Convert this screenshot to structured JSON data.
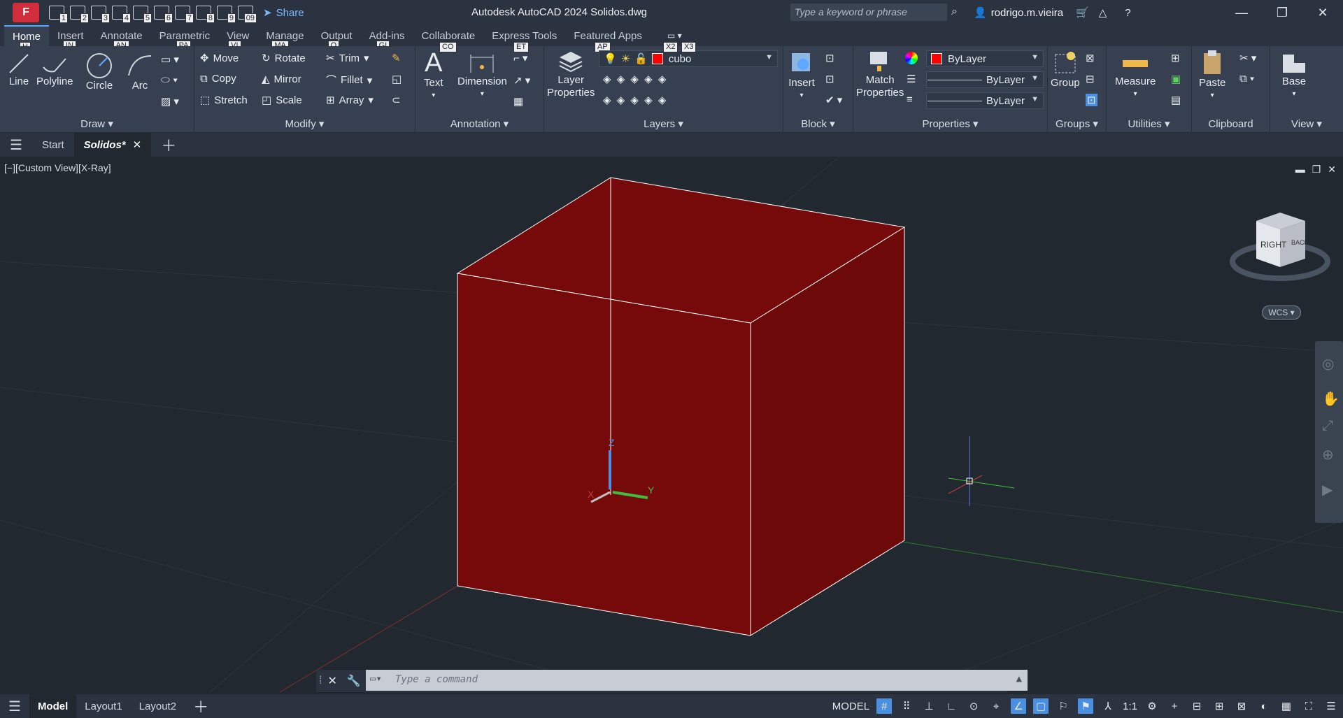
{
  "titlebar": {
    "app_title": "Autodesk AutoCAD 2024    Solidos.dwg",
    "logo_letter": "F",
    "qat_keys": [
      "1",
      "2",
      "3",
      "4",
      "5",
      "6",
      "7",
      "8",
      "9",
      "09"
    ],
    "share_label": "Share",
    "search_placeholder": "Type a keyword or phrase",
    "username": "rodrigo.m.vieira"
  },
  "ribbon_tabs": [
    {
      "label": "Home",
      "key": "H"
    },
    {
      "label": "Insert",
      "key": "IN"
    },
    {
      "label": "Annotate",
      "key": "AN"
    },
    {
      "label": "Parametric",
      "key": "PA"
    },
    {
      "label": "View",
      "key": "VI"
    },
    {
      "label": "Manage",
      "key": "MA"
    },
    {
      "label": "Output",
      "key": "O"
    },
    {
      "label": "Add-ins",
      "key": "GI"
    },
    {
      "label": "Collaborate",
      "key": ""
    },
    {
      "label": "Express Tools",
      "key": ""
    },
    {
      "label": "Featured Apps",
      "key": ""
    }
  ],
  "ribbon_extra_keys": {
    "co": "CO",
    "et": "ET",
    "ap": "AP",
    "x2": "X2",
    "x3": "X3"
  },
  "draw": {
    "panel": "Draw",
    "line": "Line",
    "polyline": "Polyline",
    "circle": "Circle",
    "arc": "Arc"
  },
  "modify": {
    "panel": "Modify",
    "move": "Move",
    "rotate": "Rotate",
    "trim": "Trim",
    "copy": "Copy",
    "mirror": "Mirror",
    "fillet": "Fillet",
    "stretch": "Stretch",
    "scale": "Scale",
    "array": "Array"
  },
  "annotation": {
    "panel": "Annotation",
    "text": "Text",
    "dimension": "Dimension"
  },
  "layers": {
    "panel": "Layers",
    "layer_properties": "Layer\nProperties",
    "current_layer": "cubo"
  },
  "block": {
    "panel": "Block",
    "insert": "Insert"
  },
  "properties": {
    "panel": "Properties",
    "match": "Match\nProperties",
    "color": "ByLayer",
    "linetype": "ByLayer",
    "lineweight": "ByLayer"
  },
  "groups": {
    "panel": "Groups",
    "group": "Group"
  },
  "utilities": {
    "panel": "Utilities",
    "measure": "Measure"
  },
  "clipboard": {
    "panel": "Clipboard",
    "paste": "Paste"
  },
  "view": {
    "panel": "View",
    "base": "Base"
  },
  "file_tabs": {
    "start": "Start",
    "active": "Solidos*"
  },
  "viewport": {
    "label": "[−][Custom View][X-Ray]",
    "wcs": "WCS",
    "viewcube_face": "RIGHT",
    "viewcube_side": "BACK"
  },
  "command": {
    "placeholder": "Type a command"
  },
  "layout_tabs": [
    "Model",
    "Layout1",
    "Layout2"
  ],
  "status": {
    "model": "MODEL",
    "scale": "1:1"
  },
  "colors": {
    "cube_fill": "#760a0a",
    "accent": "#4b8fe0",
    "layer_color": "#ff0000"
  }
}
